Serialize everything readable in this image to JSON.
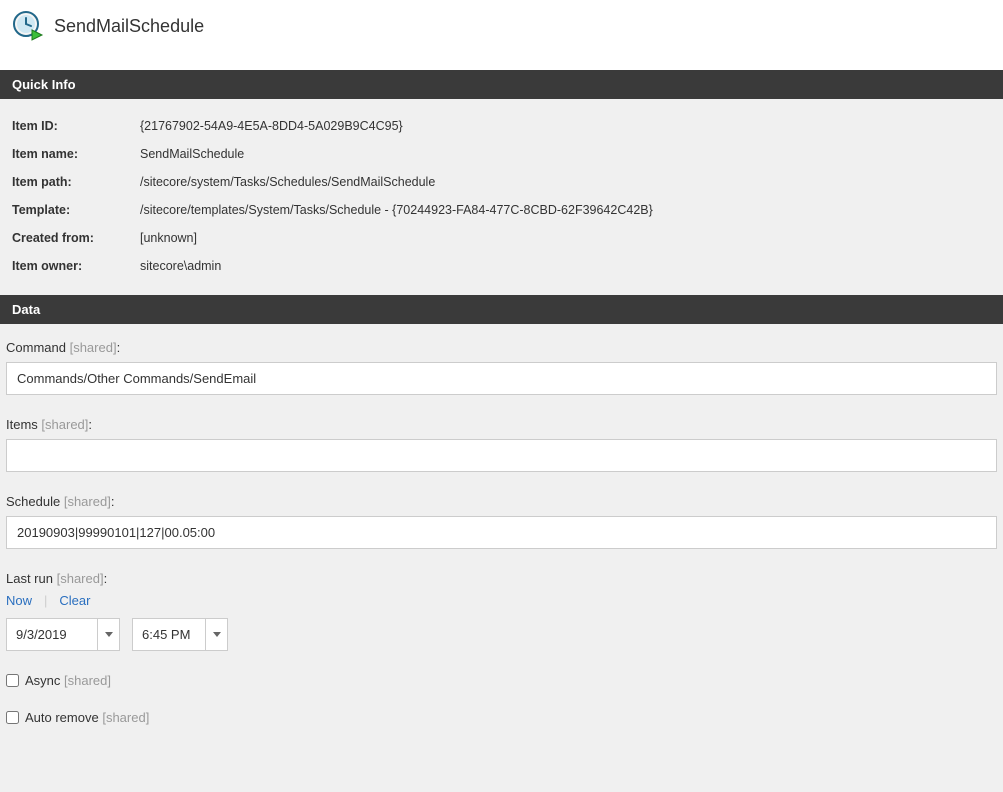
{
  "header": {
    "title": "SendMailSchedule"
  },
  "sections": {
    "quickinfo_title": "Quick Info",
    "data_title": "Data"
  },
  "quickinfo": {
    "rows": [
      {
        "label": "Item ID:",
        "value": "{21767902-54A9-4E5A-8DD4-5A029B9C4C95}"
      },
      {
        "label": "Item name:",
        "value": "SendMailSchedule"
      },
      {
        "label": "Item path:",
        "value": "/sitecore/system/Tasks/Schedules/SendMailSchedule"
      },
      {
        "label": "Template:",
        "value": "/sitecore/templates/System/Tasks/Schedule - {70244923-FA84-477C-8CBD-62F39642C42B}"
      },
      {
        "label": "Created from:",
        "value": "[unknown]"
      },
      {
        "label": "Item owner:",
        "value": "sitecore\\admin"
      }
    ]
  },
  "fields": {
    "shared_tag": "[shared]",
    "command": {
      "label": "Command",
      "value": "Commands/Other Commands/SendEmail"
    },
    "items": {
      "label": "Items",
      "value": ""
    },
    "schedule": {
      "label": "Schedule",
      "value": "20190903|99990101|127|00.05:00"
    },
    "lastrun": {
      "label": "Last run",
      "now": "Now",
      "clear": "Clear",
      "date": "9/3/2019",
      "time": "6:45 PM"
    },
    "async": {
      "label": "Async",
      "checked": false
    },
    "autoremove": {
      "label": "Auto remove",
      "checked": false
    }
  }
}
